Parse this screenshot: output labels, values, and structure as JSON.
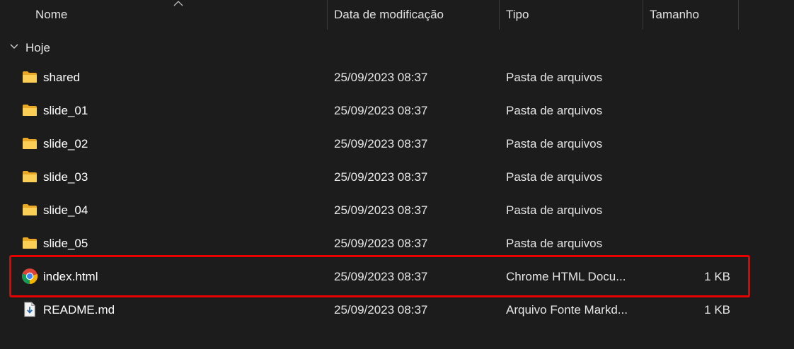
{
  "columns": {
    "name": "Nome",
    "date": "Data de modificação",
    "type": "Tipo",
    "size": "Tamanho"
  },
  "group": {
    "label": "Hoje"
  },
  "files": [
    {
      "name": "shared",
      "date": "25/09/2023 08:37",
      "type": "Pasta de arquivos",
      "size": "",
      "icon": "folder-icon"
    },
    {
      "name": "slide_01",
      "date": "25/09/2023 08:37",
      "type": "Pasta de arquivos",
      "size": "",
      "icon": "folder-icon"
    },
    {
      "name": "slide_02",
      "date": "25/09/2023 08:37",
      "type": "Pasta de arquivos",
      "size": "",
      "icon": "folder-icon"
    },
    {
      "name": "slide_03",
      "date": "25/09/2023 08:37",
      "type": "Pasta de arquivos",
      "size": "",
      "icon": "folder-icon"
    },
    {
      "name": "slide_04",
      "date": "25/09/2023 08:37",
      "type": "Pasta de arquivos",
      "size": "",
      "icon": "folder-icon"
    },
    {
      "name": "slide_05",
      "date": "25/09/2023 08:37",
      "type": "Pasta de arquivos",
      "size": "",
      "icon": "folder-icon"
    },
    {
      "name": "index.html",
      "date": "25/09/2023 08:37",
      "type": "Chrome HTML Docu...",
      "size": "1 KB",
      "icon": "chrome-icon"
    },
    {
      "name": "README.md",
      "date": "25/09/2023 08:37",
      "type": "Arquivo Fonte Markd...",
      "size": "1 KB",
      "icon": "markdown-file-icon"
    }
  ],
  "colors": {
    "background": "#1c1c1c",
    "folder": "#f8c84a",
    "highlight": "#e60000"
  }
}
